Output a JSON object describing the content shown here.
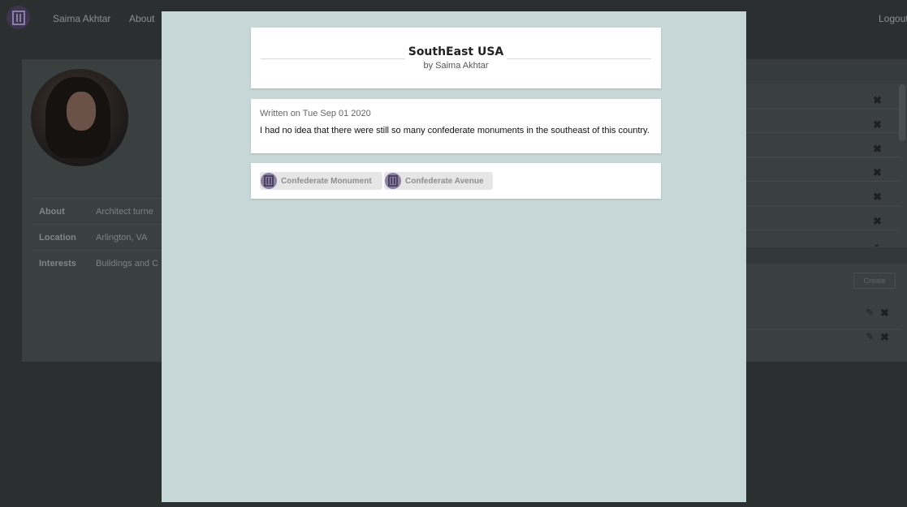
{
  "nav": {
    "user_name": "Saima Akhtar",
    "about": "About",
    "logout": "Logout"
  },
  "profile": {
    "rows": [
      {
        "label": "About",
        "value": "Architect turne"
      },
      {
        "label": "Location",
        "value": "Arlington, VA"
      },
      {
        "label": "Interests",
        "value": "Buildings and C"
      }
    ]
  },
  "right_panel": {
    "create_label": "Create"
  },
  "modal": {
    "title": "SouthEast USA",
    "byline": "by Saima Akhtar",
    "written": "Written on Tue Sep 01 2020",
    "body": "I had no idea that there were still so many confederate monuments in the southeast of this country.",
    "tags": [
      {
        "label": "Confederate Monument",
        "icon": "monument-icon"
      },
      {
        "label": "Confederate Avenue",
        "icon": "monument-icon"
      }
    ]
  },
  "colors": {
    "modal_bg": "#c7d6d6",
    "tag_icon_bg": "#8a7fa3",
    "page_bg": "#2b2f2f"
  }
}
